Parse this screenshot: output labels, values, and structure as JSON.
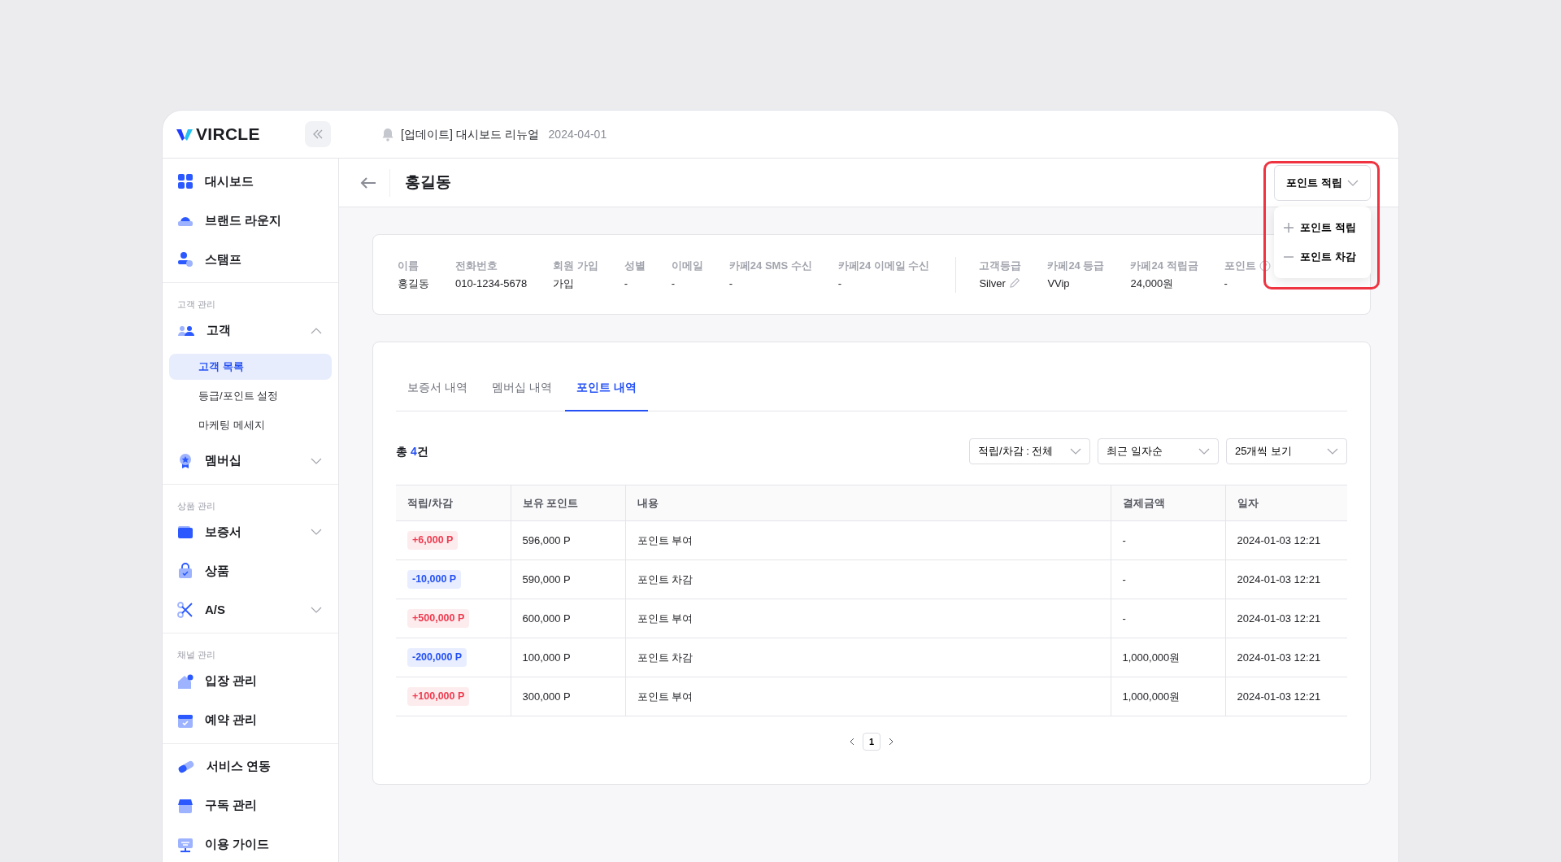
{
  "brand": {
    "name": "VIRCLE"
  },
  "notice": {
    "text": "[업데이트] 대시보드 리뉴얼",
    "date": "2024-04-01"
  },
  "sidebar": {
    "groups": [
      {
        "items": [
          {
            "label": "대시보드"
          },
          {
            "label": "브랜드 라운지"
          },
          {
            "label": "스탬프"
          }
        ]
      },
      {
        "label": "고객 관리",
        "items": [
          {
            "label": "고객",
            "expanded": true,
            "children": [
              {
                "label": "고객 목록",
                "selected": true
              },
              {
                "label": "등급/포인트 설정",
                "selected": false
              },
              {
                "label": "마케팅 메세지",
                "selected": false
              }
            ]
          },
          {
            "label": "멤버십",
            "expanded": false
          }
        ]
      },
      {
        "label": "상품 관리",
        "items": [
          {
            "label": "보증서",
            "expanded": false
          },
          {
            "label": "상품"
          },
          {
            "label": "A/S",
            "expanded": false
          }
        ]
      },
      {
        "label": "채널 관리",
        "items": [
          {
            "label": "입장 관리"
          },
          {
            "label": "예약 관리"
          }
        ]
      },
      {
        "items": [
          {
            "label": "서비스 연동"
          },
          {
            "label": "구독 관리"
          },
          {
            "label": "이용 가이드"
          }
        ]
      }
    ]
  },
  "page": {
    "title": "홍길동"
  },
  "point_button": {
    "label": "포인트 적립",
    "open": true,
    "highlighted": true,
    "menu": [
      {
        "label": "포인트 적립",
        "kind": "add"
      },
      {
        "label": "포인트 차감",
        "kind": "subtract"
      }
    ]
  },
  "member_info": [
    {
      "label": "이름",
      "value": "홍길동"
    },
    {
      "label": "전화번호",
      "value": "010-1234-5678"
    },
    {
      "label": "회원 가입",
      "value": "가입"
    },
    {
      "label": "성별",
      "value": "-"
    },
    {
      "label": "이메일",
      "value": "-"
    },
    {
      "label": "카페24 SMS 수신",
      "value": "-"
    },
    {
      "label": "카페24 이메일 수신",
      "value": "-"
    }
  ],
  "grade_info": [
    {
      "label": "고객등급",
      "value": "Silver",
      "editable": true
    },
    {
      "label": "카페24 등급",
      "value": "VVip"
    },
    {
      "label": "카페24 적립금",
      "value": "24,000원"
    },
    {
      "label": "포인트",
      "value": "-",
      "help": true
    }
  ],
  "tabs": [
    {
      "label": "보증서 내역",
      "selected": false
    },
    {
      "label": "멤버십 내역",
      "selected": false
    },
    {
      "label": "포인트 내역",
      "selected": true
    }
  ],
  "total": {
    "prefix": "총 ",
    "count": "4",
    "suffix": "건"
  },
  "filters": [
    {
      "value": "적립/차감 : 전체"
    },
    {
      "value": "최근 일자순"
    },
    {
      "value": "25개씩 보기"
    }
  ],
  "table": {
    "columns": [
      "적립/차감",
      "보유 포인트",
      "내용",
      "결제금액",
      "일자"
    ],
    "rows": [
      {
        "kind": "earn",
        "change": "+6,000 P",
        "balance": "596,000 P",
        "content": "포인트 부여",
        "payment": "-",
        "date": "2024-01-03 12:21"
      },
      {
        "kind": "deduct",
        "change": "-10,000 P",
        "balance": "590,000 P",
        "content": "포인트 차감",
        "payment": "-",
        "date": "2024-01-03 12:21"
      },
      {
        "kind": "earn",
        "change": "+500,000 P",
        "balance": "600,000 P",
        "content": "포인트 부여",
        "payment": "-",
        "date": "2024-01-03 12:21"
      },
      {
        "kind": "deduct",
        "change": "-200,000 P",
        "balance": "100,000 P",
        "content": "포인트 차감",
        "payment": "1,000,000원",
        "date": "2024-01-03 12:21"
      },
      {
        "kind": "earn",
        "change": "+100,000 P",
        "balance": "300,000 P",
        "content": "포인트 부여",
        "payment": "1,000,000원",
        "date": "2024-01-03 12:21"
      }
    ]
  },
  "pagination": [
    {
      "label": "1",
      "selected": true
    }
  ]
}
